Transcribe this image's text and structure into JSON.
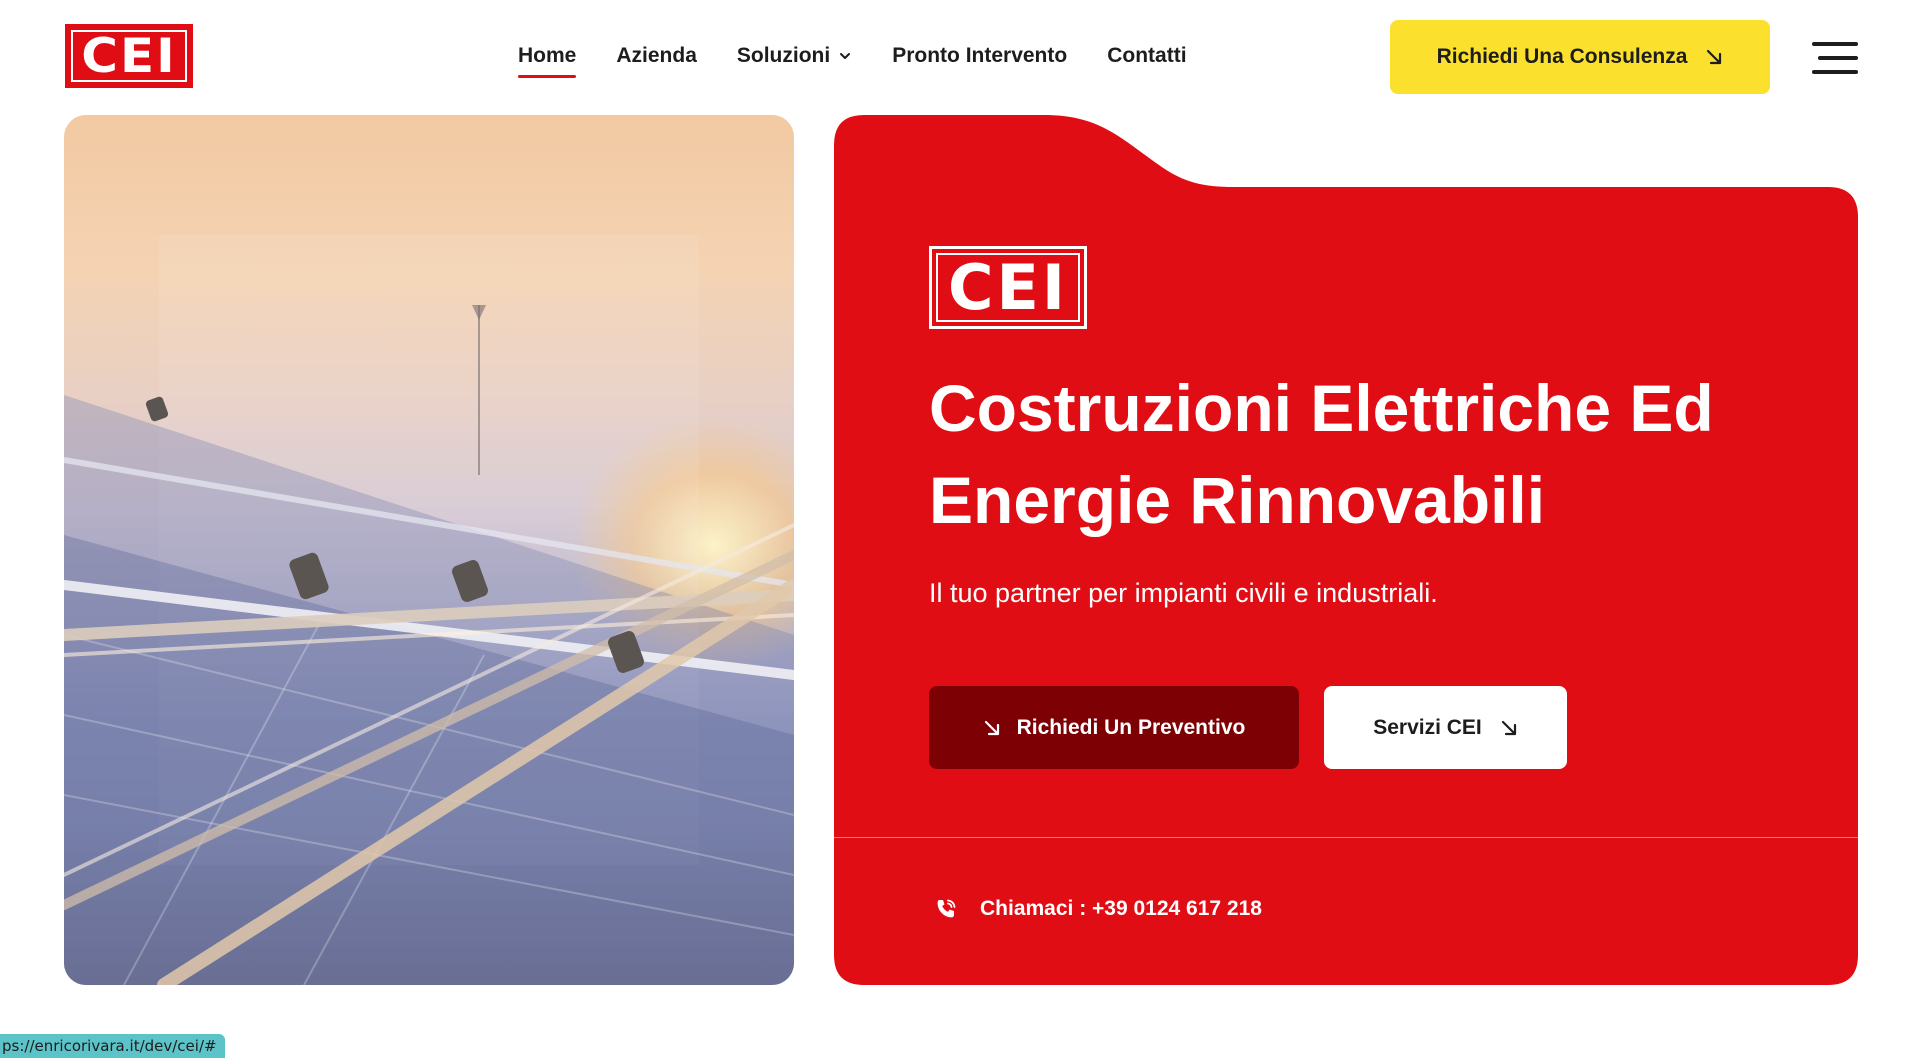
{
  "brand": {
    "logo_text": "CEI",
    "primary_color": "#e10d14",
    "dark_red": "#7d0005",
    "accent_yellow": "#fbe02d"
  },
  "nav": {
    "items": [
      {
        "label": "Home",
        "active": true
      },
      {
        "label": "Azienda"
      },
      {
        "label": "Soluzioni",
        "has_dropdown": true
      },
      {
        "label": "Pronto Intervento"
      },
      {
        "label": "Contatti"
      }
    ]
  },
  "header": {
    "cta_label": "Richiedi Una Consulenza",
    "cta_icon": "arrow-down-right-icon",
    "menu_icon": "hamburger-menu-icon"
  },
  "hero": {
    "image_subject": "solar-panels-sunset-image",
    "card_logo_text": "CEI",
    "title_line1": "Costruzioni Elettriche Ed",
    "title_line2": "Energie Rinnovabili",
    "subtitle": "Il tuo partner per impianti civili e industriali.",
    "primary_button": "Richiedi Un Preventivo",
    "secondary_button": "Servizi CEI",
    "phone_text": "Chiamaci : +39 0124 617 218",
    "phone_icon": "phone-icon"
  },
  "status_bar": {
    "url": "ps://enricorivara.it/dev/cei/#"
  }
}
